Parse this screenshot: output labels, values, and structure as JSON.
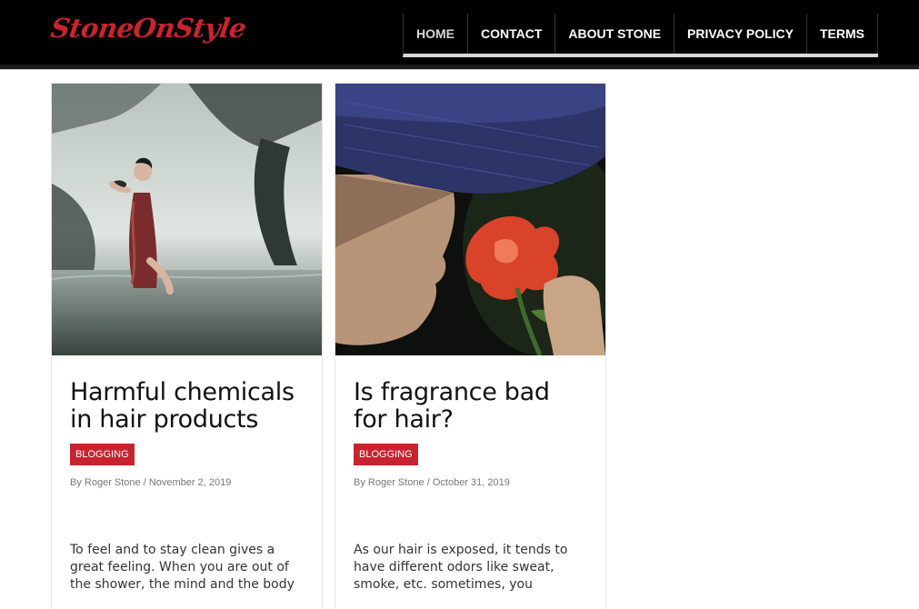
{
  "site": {
    "logo": "StoneOnStyle"
  },
  "nav": {
    "items": [
      {
        "label": "HOME",
        "active": true
      },
      {
        "label": "CONTACT",
        "active": false
      },
      {
        "label": "ABOUT STONE",
        "active": false
      },
      {
        "label": "PRIVACY POLICY",
        "active": false
      },
      {
        "label": "TERMS",
        "active": false
      }
    ]
  },
  "posts": [
    {
      "title": "Harmful chemicals in hair products",
      "category": "BLOGGING",
      "author": "By Roger Stone",
      "separator": "/",
      "date": "November 2, 2019",
      "excerpt": "To feel and to stay clean gives a great feeling. When you are out of the shower, the mind and the body"
    },
    {
      "title": "Is fragrance bad for hair?",
      "category": "BLOGGING",
      "author": "By Roger Stone",
      "separator": "/",
      "date": "October 31, 2019",
      "excerpt": "As our hair is exposed, it tends to have different odors like sweat, smoke, etc. sometimes, you"
    }
  ],
  "colors": {
    "accent": "#c8242f",
    "header_bg": "#000000"
  }
}
